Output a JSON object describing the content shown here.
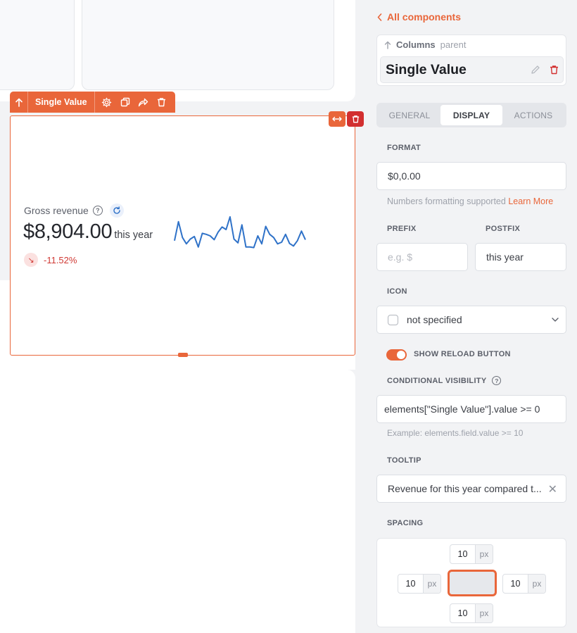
{
  "toolbar": {
    "title": "Single Value"
  },
  "widget": {
    "label": "Gross revenue",
    "value": "$8,904.00",
    "postfix": "this year",
    "delta": "-11.52%",
    "sparkline_color": "#2f72c8",
    "sparkline_values": [
      0.25,
      0.85,
      0.35,
      0.15,
      0.3,
      0.38,
      0.05,
      0.48,
      0.45,
      0.4,
      0.28,
      0.52,
      0.68,
      0.6,
      1.0,
      0.3,
      0.18,
      0.75,
      0.05,
      0.05,
      0.03,
      0.4,
      0.15,
      0.7,
      0.45,
      0.35,
      0.15,
      0.2,
      0.45,
      0.16,
      0.08,
      0.25,
      0.55,
      0.28
    ]
  },
  "panel": {
    "back_label": "All components",
    "parent_label": "Columns",
    "parent_suffix": "parent",
    "component_name": "Single Value",
    "tabs": [
      {
        "label": "GENERAL",
        "active": false
      },
      {
        "label": "DISPLAY",
        "active": true
      },
      {
        "label": "ACTIONS",
        "active": false
      }
    ],
    "format": {
      "label": "FORMAT",
      "value": "$0,0.00",
      "hint": "Numbers formatting supported",
      "hint_link": "Learn More"
    },
    "prefix": {
      "label": "PREFIX",
      "placeholder": "e.g. $"
    },
    "postfix": {
      "label": "POSTFIX",
      "value": "this year"
    },
    "icon": {
      "label": "ICON",
      "value": "not specified"
    },
    "reload": {
      "label": "SHOW RELOAD BUTTON",
      "enabled": true
    },
    "visibility": {
      "label": "CONDITIONAL VISIBILITY",
      "value": "elements[\"Single Value\"].value >= 0",
      "hint": "Example: elements.field.value >= 10"
    },
    "tooltip": {
      "label": "TOOLTIP",
      "value": "Revenue for this year compared t..."
    },
    "spacing": {
      "label": "SPACING",
      "top": "10",
      "left": "10",
      "right": "10",
      "bottom": "10",
      "unit": "px"
    }
  },
  "colors": {
    "accent": "#e9663a",
    "danger": "#d22f2f",
    "delta_negative": "#d03a35"
  }
}
